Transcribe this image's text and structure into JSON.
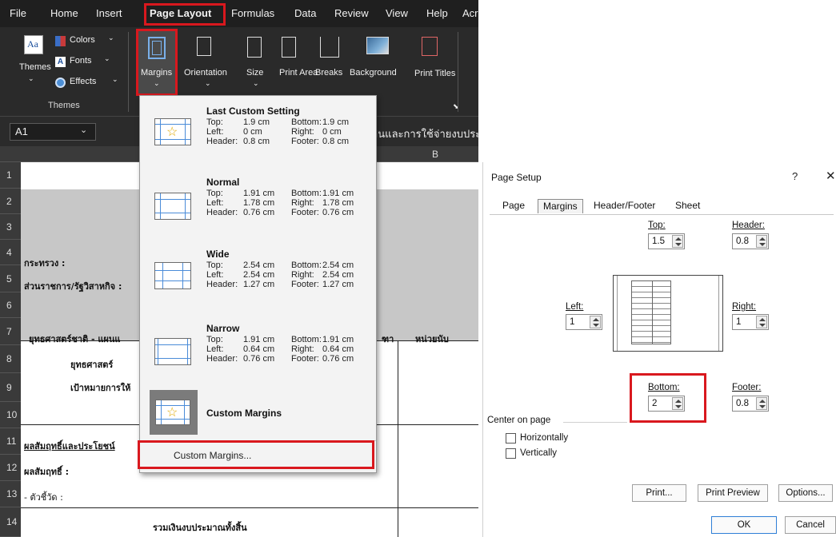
{
  "excel": {
    "menu": [
      "File",
      "Home",
      "Insert",
      "Page Layout",
      "Formulas",
      "Data",
      "Review",
      "View",
      "Help",
      "Acr"
    ],
    "ribbon": {
      "themes": {
        "label": "Themes",
        "colors": "Colors",
        "fonts": "Fonts",
        "effects": "Effects",
        "group_label": "Themes"
      },
      "margins": "Margins",
      "orientation": "Orientation",
      "size": "Size",
      "print_area": "Print Area",
      "breaks": "Breaks",
      "background": "Background",
      "print_titles": "Print Titles"
    },
    "name_box": "A1",
    "formula_text": "านและการใช้จ่ายงบประ",
    "col_b": "B",
    "row_numbers": [
      "1",
      "2",
      "3",
      "4",
      "5",
      "6",
      "7",
      "8",
      "9",
      "10",
      "11",
      "12",
      "13",
      "14"
    ],
    "cells": {
      "r4": "กระทรวง :",
      "r5": "ส่วนราชการ/รัฐวิสาหกิจ  :",
      "r7a": "ยุทธศาสตร์ชาติ - แผนแ",
      "r7b": "หน่วยนับ",
      "r7c": "ฑา",
      "r8": "ยุทธศาสตร์",
      "r9": "เป้าหมายการให้",
      "r11": "ผลสัมฤทธิ์และประโยชน์",
      "r12": "ผลสัมฤทธิ์ :",
      "r13": "- ตัวชี้วัด :",
      "r14": "รวมเงินงบประมาณทั้งสิ้น"
    }
  },
  "margins_menu": {
    "options": [
      {
        "title": "Last Custom Setting",
        "lines": [
          [
            "Top:",
            "1.9 cm",
            "Bottom:",
            "1.9 cm"
          ],
          [
            "Left:",
            "0 cm",
            "Right:",
            "0 cm"
          ],
          [
            "Header:",
            "0.8 cm",
            "Footer:",
            "0.8 cm"
          ]
        ]
      },
      {
        "title": "Normal",
        "lines": [
          [
            "Top:",
            "1.91 cm",
            "Bottom:",
            "1.91 cm"
          ],
          [
            "Left:",
            "1.78 cm",
            "Right:",
            "1.78 cm"
          ],
          [
            "Header:",
            "0.76 cm",
            "Footer:",
            "0.76 cm"
          ]
        ]
      },
      {
        "title": "Wide",
        "lines": [
          [
            "Top:",
            "2.54 cm",
            "Bottom:",
            "2.54 cm"
          ],
          [
            "Left:",
            "2.54 cm",
            "Right:",
            "2.54 cm"
          ],
          [
            "Header:",
            "1.27 cm",
            "Footer:",
            "1.27 cm"
          ]
        ]
      },
      {
        "title": "Narrow",
        "lines": [
          [
            "Top:",
            "1.91 cm",
            "Bottom:",
            "1.91 cm"
          ],
          [
            "Left:",
            "0.64 cm",
            "Right:",
            "0.64 cm"
          ],
          [
            "Header:",
            "0.76 cm",
            "Footer:",
            "0.76 cm"
          ]
        ]
      }
    ],
    "custom_title": "Custom Margins",
    "custom_item": "Custom Margins..."
  },
  "dialog": {
    "title": "Page Setup",
    "help": "?",
    "close": "✕",
    "tabs": [
      "Page",
      "Margins",
      "Header/Footer",
      "Sheet"
    ],
    "top": {
      "label": "Top:",
      "value": "1.5"
    },
    "header": {
      "label": "Header:",
      "value": "0.8"
    },
    "left": {
      "label": "Left:",
      "value": "1"
    },
    "right": {
      "label": "Right:",
      "value": "1"
    },
    "bottom": {
      "label": "Bottom:",
      "value": "2"
    },
    "footer": {
      "label": "Footer:",
      "value": "0.8"
    },
    "center_on_page": "Center on page",
    "horizontally": "Horizontally",
    "vertically": "Vertically",
    "buttons": {
      "print": "Print...",
      "print_preview": "Print Preview",
      "options": "Options...",
      "ok": "OK",
      "cancel": "Cancel"
    }
  },
  "colors": {
    "highlight": "#d9181e",
    "excel_green": "#1e7145"
  }
}
